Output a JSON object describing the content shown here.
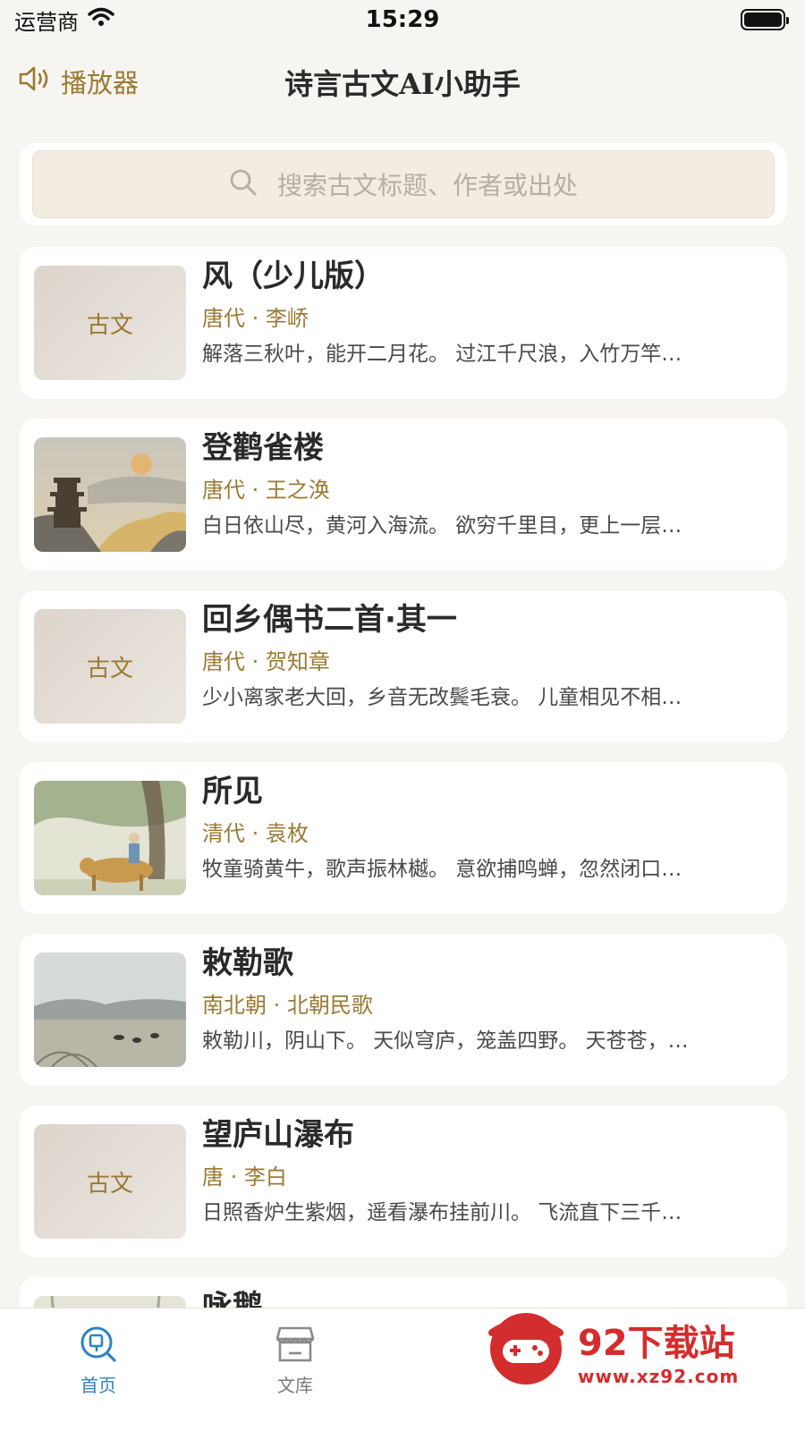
{
  "status_bar": {
    "carrier": "运营商",
    "time": "15:29"
  },
  "nav": {
    "player_label": "播放器",
    "title": "诗言古文AI小助手"
  },
  "search": {
    "placeholder": "搜索古文标题、作者或出处"
  },
  "placeholder_thumb_label": "古文",
  "poems": [
    {
      "title": "风（少儿版）",
      "meta": "唐代 · 李峤",
      "excerpt": "解落三秋叶，能开二月花。 过江千尺浪，入竹万竿…",
      "thumb": "placeholder"
    },
    {
      "title": "登鹳雀楼",
      "meta": "唐代 · 王之涣",
      "excerpt": "白日依山尽，黄河入海流。 欲穷千里目，更上一层…",
      "thumb": "landscape-tower"
    },
    {
      "title": "回乡偶书二首·其一",
      "meta": "唐代 · 贺知章",
      "excerpt": "少小离家老大回，乡音无改鬓毛衰。 儿童相见不相…",
      "thumb": "placeholder"
    },
    {
      "title": "所见",
      "meta": "清代 · 袁枚",
      "excerpt": "牧童骑黄牛，歌声振林樾。 意欲捕鸣蝉，忽然闭口…",
      "thumb": "ox-herder"
    },
    {
      "title": "敕勒歌",
      "meta": "南北朝 · 北朝民歌",
      "excerpt": "敕勒川，阴山下。 天似穹庐，笼盖四野。 天苍苍，…",
      "thumb": "grassland"
    },
    {
      "title": "望庐山瀑布",
      "meta": "唐 · 李白",
      "excerpt": "日照香炉生紫烟，遥看瀑布挂前川。 飞流直下三千…",
      "thumb": "placeholder"
    },
    {
      "title": "咏鹅",
      "meta": "",
      "excerpt": "",
      "thumb": "willow"
    }
  ],
  "tabs": [
    {
      "label": "首页",
      "icon": "home-search-icon",
      "active": true
    },
    {
      "label": "文库",
      "icon": "library-icon",
      "active": false
    }
  ],
  "watermark": {
    "title": "92下载站",
    "url": "www.xz92.com"
  },
  "colors": {
    "accent_gold": "#9a7a33",
    "tab_active": "#2f82c4",
    "watermark_red": "#d42d2d",
    "background": "#f7f5f1"
  }
}
